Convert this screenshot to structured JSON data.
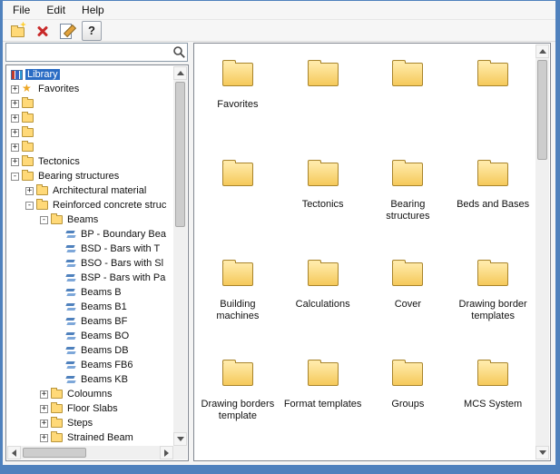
{
  "menu": {
    "items": [
      "File",
      "Edit",
      "Help"
    ]
  },
  "toolbar": {
    "icons": [
      {
        "name": "new-folder"
      },
      {
        "name": "delete"
      },
      {
        "name": "edit-properties"
      },
      {
        "name": "help",
        "glyph": "?"
      }
    ]
  },
  "search": {
    "value": ""
  },
  "tree": {
    "items": [
      {
        "label": "Library",
        "icon": "library",
        "level": 0,
        "toggle": "",
        "selected": true
      },
      {
        "label": "Favorites",
        "icon": "star",
        "level": 0,
        "toggle": "+"
      },
      {
        "label": "",
        "icon": "folder",
        "level": 0,
        "toggle": "+"
      },
      {
        "label": "",
        "icon": "folder",
        "level": 0,
        "toggle": "+"
      },
      {
        "label": "",
        "icon": "folder",
        "level": 0,
        "toggle": "+"
      },
      {
        "label": "",
        "icon": "folder",
        "level": 0,
        "toggle": "+"
      },
      {
        "label": "Tectonics",
        "icon": "folder",
        "level": 0,
        "toggle": "+"
      },
      {
        "label": "Bearing structures",
        "icon": "folder",
        "level": 0,
        "toggle": "-"
      },
      {
        "label": "Architectural material",
        "icon": "folder",
        "level": 1,
        "toggle": "+"
      },
      {
        "label": "Reinforced concrete struc",
        "icon": "folder",
        "level": 1,
        "toggle": "-"
      },
      {
        "label": "Beams",
        "icon": "folder",
        "level": 2,
        "toggle": "-"
      },
      {
        "label": "BP - Boundary Bea",
        "icon": "beam",
        "level": 3,
        "toggle": ""
      },
      {
        "label": "BSD - Bars with T",
        "icon": "beam",
        "level": 3,
        "toggle": ""
      },
      {
        "label": "BSO - Bars with Sl",
        "icon": "beam",
        "level": 3,
        "toggle": ""
      },
      {
        "label": "BSP - Bars with Pa",
        "icon": "beam",
        "level": 3,
        "toggle": ""
      },
      {
        "label": "Beams B",
        "icon": "beam",
        "level": 3,
        "toggle": ""
      },
      {
        "label": "Beams B1",
        "icon": "beam",
        "level": 3,
        "toggle": ""
      },
      {
        "label": "Beams BF",
        "icon": "beam",
        "level": 3,
        "toggle": ""
      },
      {
        "label": "Beams BO",
        "icon": "beam",
        "level": 3,
        "toggle": ""
      },
      {
        "label": "Beams DB",
        "icon": "beam",
        "level": 3,
        "toggle": ""
      },
      {
        "label": "Beams FB6",
        "icon": "beam",
        "level": 3,
        "toggle": ""
      },
      {
        "label": "Beams KB",
        "icon": "beam",
        "level": 3,
        "toggle": ""
      },
      {
        "label": "Coloumns",
        "icon": "folder",
        "level": 2,
        "toggle": "+"
      },
      {
        "label": "Floor Slabs",
        "icon": "folder",
        "level": 2,
        "toggle": "+"
      },
      {
        "label": "Steps",
        "icon": "folder",
        "level": 2,
        "toggle": "+"
      },
      {
        "label": "Strained Beam",
        "icon": "folder",
        "level": 2,
        "toggle": "+"
      }
    ]
  },
  "content": {
    "items": [
      "Favorites",
      "",
      "",
      "",
      "",
      "Tectonics",
      "Bearing structures",
      "Beds and Bases",
      "Building machines",
      "Calculations",
      "Cover",
      "Drawing border templates",
      "Drawing borders template",
      "Format templates",
      "Groups",
      "MCS System"
    ]
  },
  "colors": {
    "window_frame": "#4f81bd",
    "selection_bg": "#2a6cc4",
    "selection_text": "#ffffff",
    "folder_fill": "#ffd978"
  }
}
